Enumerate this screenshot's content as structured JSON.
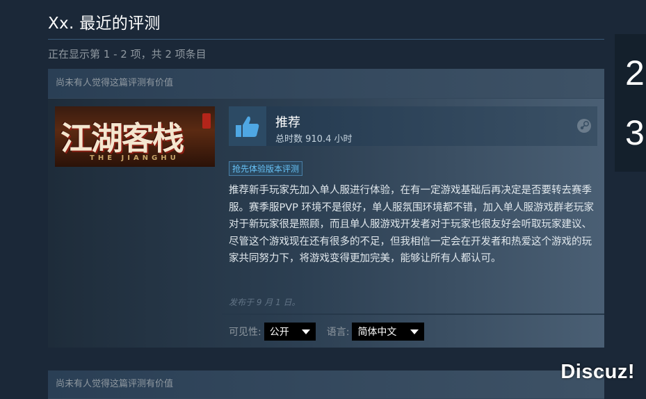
{
  "page": {
    "title": "Xx. 最近的评测",
    "showing": "正在显示第 1 - 2 项，共 2 项条目"
  },
  "reviews": [
    {
      "helpful": "尚未有人觉得这篇评测有价值",
      "game": {
        "title_cn": "江湖客栈",
        "title_en": "THE JIANGHU"
      },
      "verdict": "推荐",
      "hours": "总时数 910.4 小时",
      "badge": "抢先体验版本评测",
      "text": "推荐新手玩家先加入单人服进行体验，在有一定游戏基础后再决定是否要转去赛季服。赛季服PVP 环境不是很好，单人服氛围环境都不错，加入单人服游戏群老玩家对于新玩家很是照顾，而且单人服游戏开发者对于玩家也很友好会听取玩家建议、尽管这个游戏现在还有很多的不足，但我相信一定会在开发者和热爱这个游戏的玩家共同努力下，将游戏变得更加完美，能够让所有人都认可。",
      "posted": "发布于 9 月 1 日。",
      "visibility_label": "可见性:",
      "visibility_value": "公开",
      "language_label": "语言:",
      "language_value": "简体中文"
    },
    {
      "helpful": "尚未有人觉得这篇评测有价值"
    }
  ],
  "side_panel": {
    "digit1": "2",
    "digit2": "3"
  },
  "watermark": "Discuz!",
  "colors": {
    "background": "#1b2838",
    "accent": "#67c1f5",
    "thumb": "#4fa7e3"
  },
  "icons": [
    "thumbs-up-icon",
    "steam-logo-icon",
    "chevron-down-icon"
  ]
}
